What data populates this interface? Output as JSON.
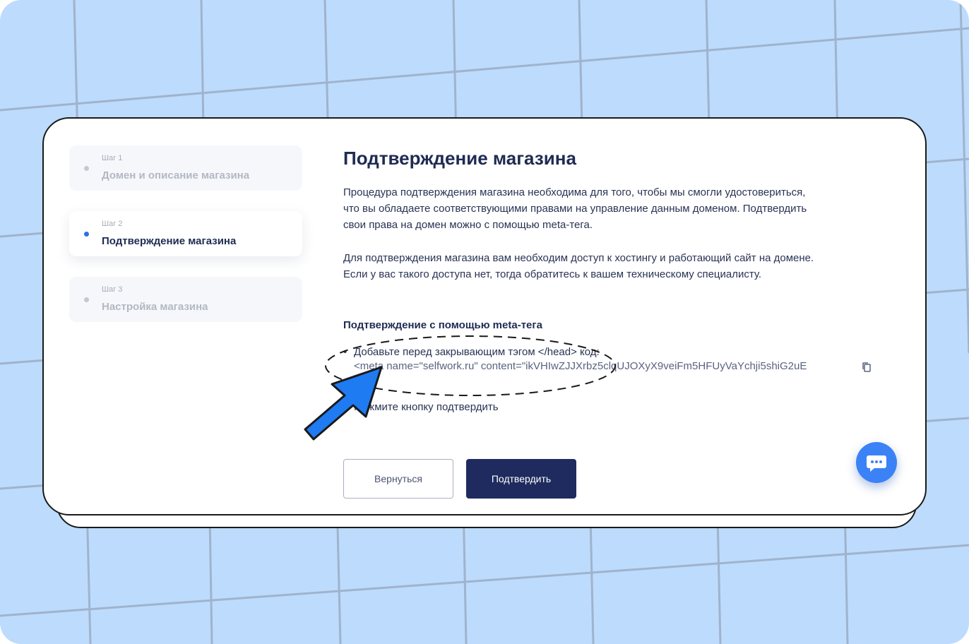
{
  "steps": [
    {
      "label": "Шаг 1",
      "title": "Домен и описание магазина",
      "active": false
    },
    {
      "label": "Шаг 2",
      "title": "Подтверждение магазина",
      "active": true
    },
    {
      "label": "Шаг 3",
      "title": "Настройка магазина",
      "active": false
    }
  ],
  "content": {
    "title": "Подтверждение магазина",
    "paragraph1": "Процедура подтверждения магазина необходима для того, чтобы мы смогли удостовериться, что вы обладаете соответствующими правами на управление данным доменом. Подтвердить свои права на домен можно с помощью meta-тега.",
    "paragraph2": "Для подтверждения магазина вам необходим доступ к хостингу и работающий сайт на домене. Если у вас такого доступа нет, тогда обратитесь к вашем техническому специалисту.",
    "subtitle": "Подтверждение с помощью meta-тега",
    "bullet_marker": "•",
    "step1_text": "Добавьте перед закрывающим тэгом </head> код:",
    "meta_code": "<meta name=\"selfwork.ru\" content=\"ikVHIwZJJXrbz5clqUJOXyX9veiFm5HFUyVaYchji5shiG2uE",
    "step2_text": "Нажмите кнопку подтвердить"
  },
  "buttons": {
    "back": "Вернуться",
    "confirm": "Подтвердить"
  },
  "colors": {
    "background": "#bddbfd",
    "primary": "#1f2b5e",
    "accent": "#2f6fe4",
    "chat": "#3b82f6",
    "arrow": "#1e7bf2"
  },
  "icons": {
    "copy": "copy-icon",
    "chat": "chat-bubble-icon",
    "arrow": "pointer-arrow-icon"
  }
}
